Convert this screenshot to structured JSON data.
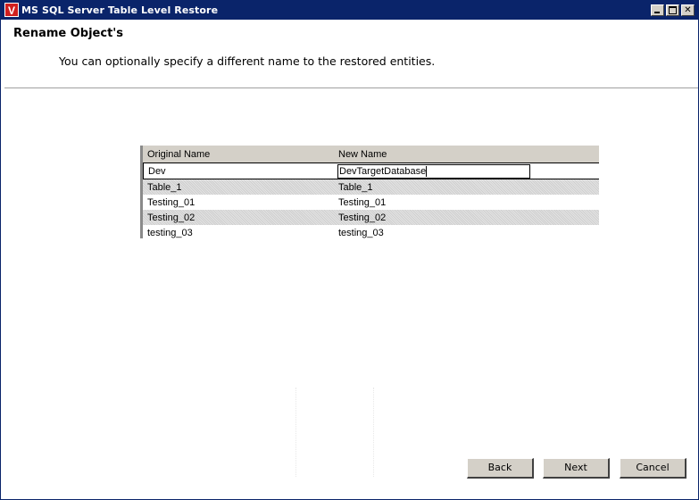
{
  "window": {
    "title": "MS SQL Server Table Level Restore",
    "icon_glyph": "V",
    "minimize_glyph": "",
    "maximize_glyph": "",
    "close_glyph": "✕"
  },
  "header": {
    "title": "Rename Object's",
    "subtitle": "You can optionally specify a different name to the restored entities."
  },
  "grid": {
    "columns": [
      "Original Name",
      "New Name"
    ],
    "rows": [
      {
        "original": "Dev",
        "new_name": "DevTargetDatabase"
      },
      {
        "original": "Table_1",
        "new_name": "Table_1"
      },
      {
        "original": "Testing_01",
        "new_name": "Testing_01"
      },
      {
        "original": "Testing_02",
        "new_name": "Testing_02"
      },
      {
        "original": "testing_03",
        "new_name": "testing_03"
      }
    ]
  },
  "buttons": {
    "back": "Back",
    "next": "Next",
    "cancel": "Cancel"
  },
  "colors": {
    "titlebar": "#0a246a",
    "button_face": "#d4d0c8",
    "icon_red": "#d01f1f"
  }
}
